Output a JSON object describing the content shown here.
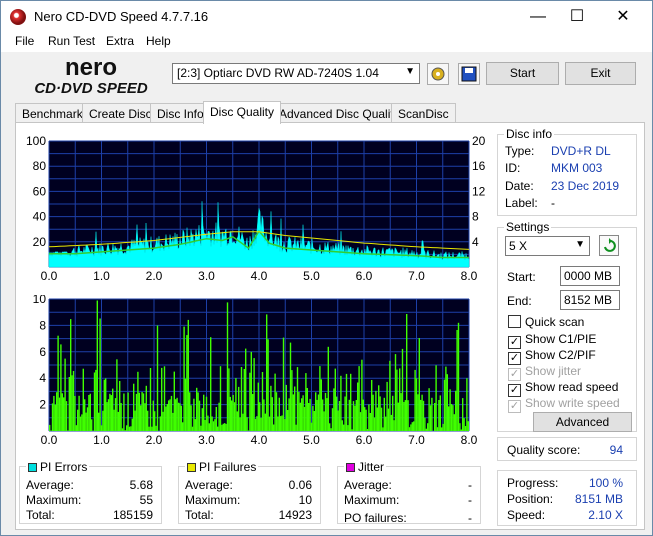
{
  "window": {
    "title": "Nero CD-DVD Speed 4.7.7.16",
    "minimize": "—",
    "maximize": "☐",
    "close": "✕"
  },
  "menu": [
    "File",
    "Run Test",
    "Extra",
    "Help"
  ],
  "logo": {
    "line1": "nero",
    "line2": "CD·DVD SPEED"
  },
  "toolbar": {
    "drive": "[2:3]   Optiarc DVD RW AD-7240S 1.04",
    "start_label": "Start",
    "exit_label": "Exit"
  },
  "tabs": [
    "Benchmark",
    "Create Disc",
    "Disc Info",
    "Disc Quality",
    "Advanced Disc Quality",
    "ScanDisc"
  ],
  "active_tab": "Disc Quality",
  "disc_info": {
    "title": "Disc info",
    "type_label": "Type:",
    "type": "DVD+R DL",
    "id_label": "ID:",
    "id": "MKM 003",
    "date_label": "Date:",
    "date": "23 Dec 2019",
    "label_label": "Label:",
    "label": "-"
  },
  "settings": {
    "title": "Settings",
    "speed": "5 X",
    "start_label": "Start:",
    "start": "0000 MB",
    "end_label": "End:",
    "end": "8152 MB",
    "quick_scan": "Quick scan",
    "show_c1pie": "Show C1/PIE",
    "show_c2pif": "Show C2/PIF",
    "show_jitter": "Show jitter",
    "show_read_speed": "Show read speed",
    "show_write_speed": "Show write speed",
    "advanced_label": "Advanced"
  },
  "quality": {
    "label": "Quality score:",
    "value": "94"
  },
  "progress": {
    "progress_label": "Progress:",
    "progress": "100 %",
    "position_label": "Position:",
    "position": "8151 MB",
    "speed_label": "Speed:",
    "speed": "2.10 X"
  },
  "pi_errors": {
    "title": "PI Errors",
    "color": "#00e0e0",
    "avg_label": "Average:",
    "avg": "5.68",
    "max_label": "Maximum:",
    "max": "55",
    "total_label": "Total:",
    "total": "185159"
  },
  "pi_failures": {
    "title": "PI Failures",
    "color": "#e8e800",
    "avg_label": "Average:",
    "avg": "0.06",
    "max_label": "Maximum:",
    "max": "10",
    "total_label": "Total:",
    "total": "14923"
  },
  "jitter": {
    "title": "Jitter",
    "color": "#e000e0",
    "avg_label": "Average:",
    "avg": "-",
    "max_label": "Maximum:",
    "max": "-",
    "po_label": "PO failures:",
    "po": "-"
  },
  "chart_data": [
    {
      "type": "area",
      "name": "PI Errors",
      "xlim": [
        0,
        8
      ],
      "ylim": [
        0,
        100
      ],
      "y2lim": [
        0,
        20
      ],
      "yticks": [
        20,
        40,
        60,
        80,
        100
      ],
      "y2ticks": [
        4,
        8,
        12,
        16,
        20
      ],
      "xticks": [
        "0.0",
        "1.0",
        "2.0",
        "3.0",
        "4.0",
        "5.0",
        "6.0",
        "7.0",
        "8.0"
      ],
      "series": [
        {
          "values_x": [
            0,
            0.5,
            1,
            1.5,
            2,
            2.5,
            3,
            3.3,
            3.5,
            3.8,
            4,
            4.2,
            4.5,
            5,
            5.5,
            6,
            6.5,
            7,
            7.5,
            8
          ],
          "values_y": [
            14,
            14,
            16,
            18,
            20,
            24,
            30,
            28,
            32,
            20,
            38,
            25,
            20,
            18,
            16,
            14,
            13,
            12,
            10,
            10
          ]
        },
        {
          "values_x": [
            0,
            1,
            2,
            3,
            3.5,
            4,
            4.5,
            5,
            6,
            7,
            8
          ],
          "values_y": [
            3.2,
            3.6,
            4.2,
            5.2,
            5.6,
            5.6,
            5.0,
            4.6,
            3.8,
            3.2,
            2.8
          ]
        }
      ]
    },
    {
      "type": "bar",
      "name": "PI Failures",
      "xlim": [
        0,
        8
      ],
      "ylim": [
        0,
        10
      ],
      "yticks": [
        2,
        4,
        6,
        8,
        10
      ],
      "xticks": [
        "0.0",
        "1.0",
        "2.0",
        "3.0",
        "4.0",
        "5.0",
        "6.0",
        "7.0",
        "8.0"
      ],
      "series": [
        {
          "values_max": 10,
          "values_avg": 0.06
        }
      ]
    }
  ]
}
